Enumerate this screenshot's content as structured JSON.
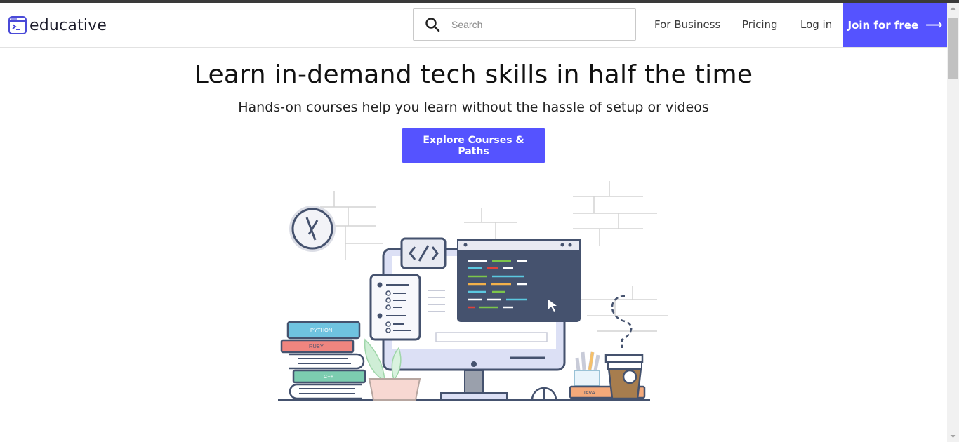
{
  "header": {
    "logo_text": "educative",
    "search": {
      "placeholder": "Search"
    },
    "nav": {
      "business": "For Business",
      "pricing": "Pricing",
      "login": "Log in"
    },
    "join": {
      "label": "Join for free",
      "arrow": "⟶"
    }
  },
  "hero": {
    "title": "Learn in-demand tech skills in half the time",
    "subtitle": "Hands-on courses help you learn without the hassle of setup or videos",
    "cta_label": "Explore Courses & Paths",
    "books": {
      "python": "PYTHON",
      "ruby": "RUBY",
      "cpp": "C++",
      "java": "JAVA"
    }
  },
  "colors": {
    "accent": "#5553ff",
    "illustration_dark": "#45526e",
    "illustration_light": "#dce0f5"
  },
  "icons": [
    "educative-logo-icon",
    "search-icon",
    "arrow-right-icon",
    "code-icon",
    "cursor-icon",
    "clock-icon"
  ]
}
